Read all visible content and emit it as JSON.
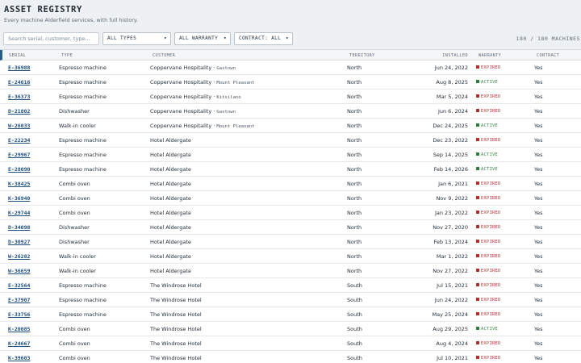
{
  "header": {
    "title": "ASSET REGISTRY",
    "subtitle": "Every machine Alderfield services, with full history."
  },
  "filters": {
    "search_placeholder": "Search serial, customer, type...",
    "type_select": "ALL TYPES",
    "warranty_select": "ALL WARRANTY",
    "contract_select": "CONTRACT: ALL",
    "chevron_icon": "chevron-down-icon"
  },
  "count_label": "180 / 180 MACHINES",
  "table": {
    "columns": [
      "SERIAL",
      "TYPE",
      "CUSTOMER",
      "TERRITORY",
      "INSTALLED",
      "WARRANTY",
      "CONTRACT"
    ],
    "rows": [
      {
        "serial": "E-36988",
        "type": "Espresso machine",
        "customer": "Coppervane Hospitality",
        "location": "Gastown",
        "territory": "North",
        "installed": "Jun 24, 2022",
        "warranty": "EXPIRED",
        "contract": "Yes"
      },
      {
        "serial": "E-24616",
        "type": "Espresso machine",
        "customer": "Coppervane Hospitality",
        "location": "Mount Pleasant",
        "territory": "North",
        "installed": "Aug 8, 2025",
        "warranty": "ACTIVE",
        "contract": "Yes"
      },
      {
        "serial": "E-36373",
        "type": "Espresso machine",
        "customer": "Coppervane Hospitality",
        "location": "Kitsilano",
        "territory": "North",
        "installed": "Mar 5, 2024",
        "warranty": "EXPIRED",
        "contract": "Yes"
      },
      {
        "serial": "D-21802",
        "type": "Dishwasher",
        "customer": "Coppervane Hospitality",
        "location": "Gastown",
        "territory": "North",
        "installed": "Jun 6, 2024",
        "warranty": "EXPIRED",
        "contract": "Yes"
      },
      {
        "serial": "W-26033",
        "type": "Walk-in cooler",
        "customer": "Coppervane Hospitality",
        "location": "Mount Pleasant",
        "territory": "North",
        "installed": "Dec 24, 2025",
        "warranty": "ACTIVE",
        "contract": "Yes"
      },
      {
        "serial": "E-22234",
        "type": "Espresso machine",
        "customer": "Hotel Aldergate",
        "location": "",
        "territory": "North",
        "installed": "Dec 23, 2022",
        "warranty": "EXPIRED",
        "contract": "Yes"
      },
      {
        "serial": "E-29967",
        "type": "Espresso machine",
        "customer": "Hotel Aldergate",
        "location": "",
        "territory": "North",
        "installed": "Sep 14, 2025",
        "warranty": "ACTIVE",
        "contract": "Yes"
      },
      {
        "serial": "E-28090",
        "type": "Espresso machine",
        "customer": "Hotel Aldergate",
        "location": "",
        "territory": "North",
        "installed": "Feb 14, 2026",
        "warranty": "ACTIVE",
        "contract": "Yes"
      },
      {
        "serial": "K-38425",
        "type": "Combi oven",
        "customer": "Hotel Aldergate",
        "location": "",
        "territory": "North",
        "installed": "Jan 6, 2021",
        "warranty": "EXPIRED",
        "contract": "Yes"
      },
      {
        "serial": "K-36940",
        "type": "Combi oven",
        "customer": "Hotel Aldergate",
        "location": "",
        "territory": "North",
        "installed": "Nov 9, 2022",
        "warranty": "EXPIRED",
        "contract": "Yes"
      },
      {
        "serial": "K-29744",
        "type": "Combi oven",
        "customer": "Hotel Aldergate",
        "location": "",
        "territory": "North",
        "installed": "Jan 23, 2022",
        "warranty": "EXPIRED",
        "contract": "Yes"
      },
      {
        "serial": "D-34098",
        "type": "Dishwasher",
        "customer": "Hotel Aldergate",
        "location": "",
        "territory": "North",
        "installed": "Nov 27, 2020",
        "warranty": "EXPIRED",
        "contract": "Yes"
      },
      {
        "serial": "D-30927",
        "type": "Dishwasher",
        "customer": "Hotel Aldergate",
        "location": "",
        "territory": "North",
        "installed": "Feb 13, 2024",
        "warranty": "EXPIRED",
        "contract": "Yes"
      },
      {
        "serial": "W-26282",
        "type": "Walk-in cooler",
        "customer": "Hotel Aldergate",
        "location": "",
        "territory": "North",
        "installed": "Mar 1, 2022",
        "warranty": "EXPIRED",
        "contract": "Yes"
      },
      {
        "serial": "W-36659",
        "type": "Walk-in cooler",
        "customer": "Hotel Aldergate",
        "location": "",
        "territory": "North",
        "installed": "Nov 27, 2022",
        "warranty": "EXPIRED",
        "contract": "Yes"
      },
      {
        "serial": "E-32564",
        "type": "Espresso machine",
        "customer": "The Windrose Hotel",
        "location": "",
        "territory": "South",
        "installed": "Jul 15, 2021",
        "warranty": "EXPIRED",
        "contract": "Yes"
      },
      {
        "serial": "E-37907",
        "type": "Espresso machine",
        "customer": "The Windrose Hotel",
        "location": "",
        "territory": "South",
        "installed": "Jun 24, 2022",
        "warranty": "EXPIRED",
        "contract": "Yes"
      },
      {
        "serial": "E-33756",
        "type": "Espresso machine",
        "customer": "The Windrose Hotel",
        "location": "",
        "territory": "South",
        "installed": "May 25, 2024",
        "warranty": "EXPIRED",
        "contract": "Yes"
      },
      {
        "serial": "K-20085",
        "type": "Combi oven",
        "customer": "The Windrose Hotel",
        "location": "",
        "territory": "South",
        "installed": "Aug 29, 2025",
        "warranty": "ACTIVE",
        "contract": "Yes"
      },
      {
        "serial": "K-24667",
        "type": "Combi oven",
        "customer": "The Windrose Hotel",
        "location": "",
        "territory": "South",
        "installed": "Aug 4, 2024",
        "warranty": "EXPIRED",
        "contract": "Yes"
      },
      {
        "serial": "K-39603",
        "type": "Combi oven",
        "customer": "The Windrose Hotel",
        "location": "",
        "territory": "South",
        "installed": "Jul 10, 2021",
        "warranty": "EXPIRED",
        "contract": "Yes"
      }
    ]
  },
  "colors": {
    "expired": "#b0302b",
    "active": "#2f7d3d",
    "link": "#1d4f80",
    "accent_bar": "#2b5d8a"
  }
}
